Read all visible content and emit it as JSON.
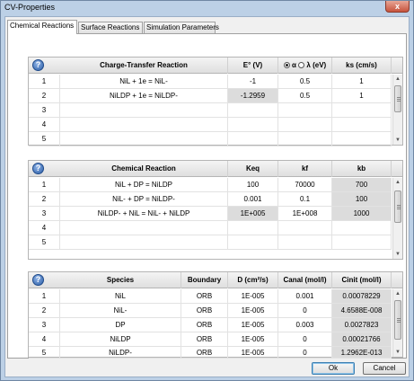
{
  "window": {
    "title": "CV-Properties",
    "close_glyph": "x"
  },
  "tabs": [
    {
      "label": "Chemical Reactions",
      "active": true
    },
    {
      "label": "Surface Reactions",
      "active": false
    },
    {
      "label": "Simulation Parameters",
      "active": false
    }
  ],
  "charge_transfer": {
    "help": "?",
    "headers": [
      "Charge-Transfer Reaction",
      "E° (V)",
      "α",
      "λ (eV)",
      "ks (cm/s)"
    ],
    "alpha_selected": true,
    "rows": [
      {
        "n": "1",
        "reaction": "NiL + 1e = NiL-",
        "e0": "-1",
        "alpha": "0.5",
        "ks": "1"
      },
      {
        "n": "2",
        "reaction": "NiLDP + 1e = NiLDP-",
        "e0": "-1.2959",
        "alpha": "0.5",
        "ks": "1"
      },
      {
        "n": "3",
        "reaction": "",
        "e0": "",
        "alpha": "",
        "ks": ""
      },
      {
        "n": "4",
        "reaction": "",
        "e0": "",
        "alpha": "",
        "ks": ""
      },
      {
        "n": "5",
        "reaction": "",
        "e0": "",
        "alpha": "",
        "ks": ""
      }
    ]
  },
  "chemical": {
    "help": "?",
    "headers": [
      "Chemical Reaction",
      "Keq",
      "kf",
      "kb"
    ],
    "rows": [
      {
        "n": "1",
        "reaction": "NiL + DP = NiLDP",
        "keq": "100",
        "kf": "70000",
        "kb": "700"
      },
      {
        "n": "2",
        "reaction": "NiL- + DP = NiLDP-",
        "keq": "0.001",
        "kf": "0.1",
        "kb": "100"
      },
      {
        "n": "3",
        "reaction": "NiLDP- + NiL = NiL- + NiLDP",
        "keq": "1E+005",
        "kf": "1E+008",
        "kb": "1000"
      },
      {
        "n": "4",
        "reaction": "",
        "keq": "",
        "kf": "",
        "kb": ""
      },
      {
        "n": "5",
        "reaction": "",
        "keq": "",
        "kf": "",
        "kb": ""
      }
    ]
  },
  "species": {
    "help": "?",
    "headers": [
      "Species",
      "Boundary",
      "D (cm²/s)",
      "Canal (mol/l)",
      "Cinit (mol/l)"
    ],
    "rows": [
      {
        "n": "1",
        "species": "NiL",
        "boundary": "ORB",
        "d": "1E-005",
        "canal": "0.001",
        "cinit": "0.00078229"
      },
      {
        "n": "2",
        "species": "NiL-",
        "boundary": "ORB",
        "d": "1E-005",
        "canal": "0",
        "cinit": "4.6588E-008"
      },
      {
        "n": "3",
        "species": "DP",
        "boundary": "ORB",
        "d": "1E-005",
        "canal": "0.003",
        "cinit": "0.0027823"
      },
      {
        "n": "4",
        "species": "NiLDP",
        "boundary": "ORB",
        "d": "1E-005",
        "canal": "0",
        "cinit": "0.00021766"
      },
      {
        "n": "5",
        "species": "NiLDP-",
        "boundary": "ORB",
        "d": "1E-005",
        "canal": "0",
        "cinit": "1.2962E-013"
      }
    ]
  },
  "buttons": {
    "ok": "Ok",
    "cancel": "Cancel"
  }
}
